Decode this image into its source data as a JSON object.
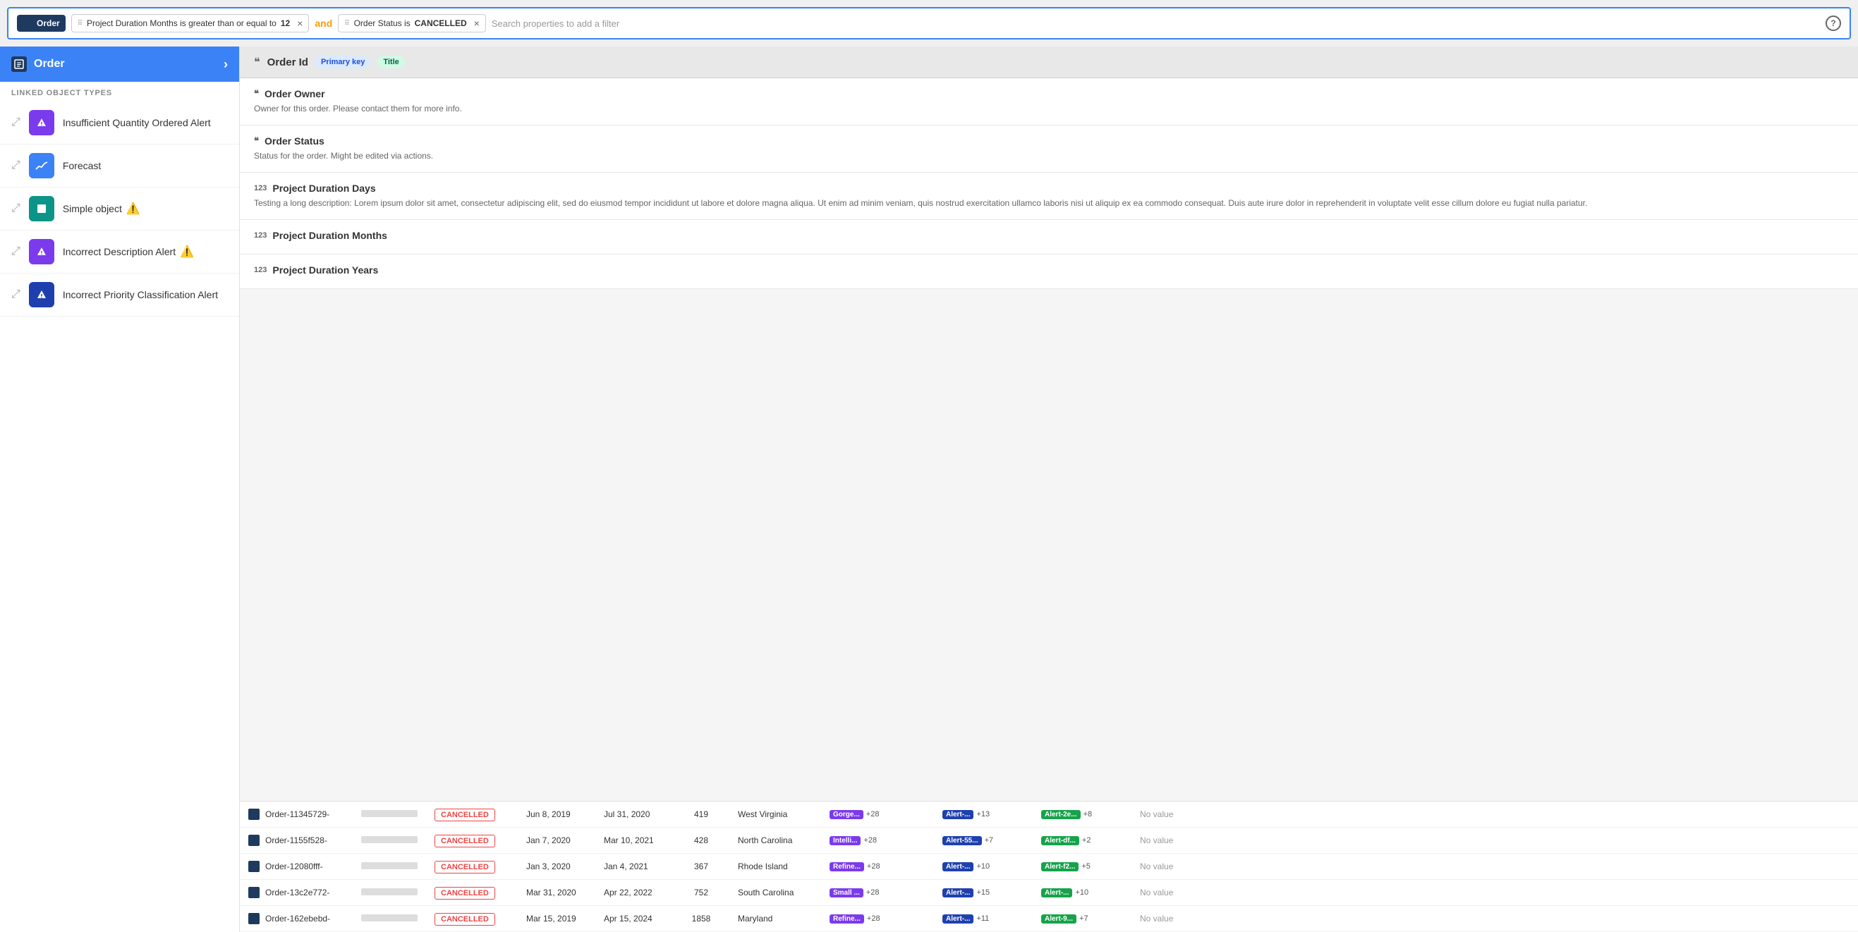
{
  "filter_bar": {
    "chip_label": "Order",
    "filter1_dots": "⠿",
    "filter1_text": "Project Duration Months is greater than or equal to",
    "filter1_value": "12",
    "filter1_close": "×",
    "and_label": "and",
    "filter2_dots": "⠿",
    "filter2_text": "Order Status is",
    "filter2_value": "CANCELLED",
    "filter2_close": "×",
    "search_placeholder": "Search properties to add a filter",
    "help_label": "?"
  },
  "sidebar": {
    "header_label": "Order",
    "linked_label": "LINKED OBJECT TYPES",
    "items": [
      {
        "name": "Insufficient Quantity Ordered Alert",
        "icon_type": "purple",
        "icon_char": "⚑",
        "has_warning": false
      },
      {
        "name": "Forecast",
        "icon_type": "blue",
        "icon_char": "📈",
        "has_warning": false
      },
      {
        "name": "Simple object",
        "icon_type": "teal",
        "icon_char": "◼",
        "has_warning": true
      },
      {
        "name": "Incorrect Description Alert",
        "icon_type": "purple",
        "icon_char": "⚑",
        "has_warning": true
      },
      {
        "name": "Incorrect Priority Classification Alert",
        "icon_type": "navy",
        "icon_char": "⚑",
        "has_warning": false
      }
    ]
  },
  "right_panel": {
    "header_field": "Order Id",
    "badge_primary": "Primary key",
    "badge_title": "Title",
    "quote_icon": "❝",
    "properties": [
      {
        "icon": "❝",
        "name": "Order Owner",
        "desc": "Owner for this order. Please contact them for more info.",
        "type": "quote"
      },
      {
        "icon": "❝",
        "name": "Order Status",
        "desc": "Status for the order. Might be edited via actions.",
        "type": "quote"
      },
      {
        "icon": "123",
        "name": "Project Duration Days",
        "desc": "Testing a long description: Lorem ipsum dolor sit amet, consectetur adipiscing elit, sed do eiusmod tempor incididunt ut labore et dolore magna aliqua. Ut enim ad minim veniam, quis nostrud exercitation ullamco laboris nisi ut aliquip ex ea commodo consequat. Duis aute irure dolor in reprehenderit in voluptate velit esse cillum dolore eu fugiat nulla pariatur.",
        "type": "number"
      },
      {
        "icon": "123",
        "name": "Project Duration Months",
        "desc": "",
        "type": "number"
      },
      {
        "icon": "123",
        "name": "Project Duration Years",
        "desc": "",
        "type": "number"
      }
    ]
  },
  "table": {
    "rows": [
      {
        "order_id": "Order-11345729-",
        "status": "CANCELLED",
        "date1": "Jun 8, 2019",
        "date2": "Jul 31, 2020",
        "num": "419",
        "state": "West Virginia",
        "tag1": "Gorge...",
        "tag1_count": "+28",
        "tag2": "Alert-...",
        "tag2_count": "+13",
        "tag3": "Alert-2e...",
        "tag3_count": "+8",
        "novalue": "No value"
      },
      {
        "order_id": "Order-1155f528-",
        "status": "CANCELLED",
        "date1": "Jan 7, 2020",
        "date2": "Mar 10, 2021",
        "num": "428",
        "state": "North Carolina",
        "tag1": "Intelli...",
        "tag1_count": "+28",
        "tag2": "Alert-55...",
        "tag2_count": "+7",
        "tag3": "Alert-df...",
        "tag3_count": "+2",
        "novalue": "No value"
      },
      {
        "order_id": "Order-12080fff-",
        "status": "CANCELLED",
        "date1": "Jan 3, 2020",
        "date2": "Jan 4, 2021",
        "num": "367",
        "state": "Rhode Island",
        "tag1": "Refine...",
        "tag1_count": "+28",
        "tag2": "Alert-...",
        "tag2_count": "+10",
        "tag3": "Alert-f2...",
        "tag3_count": "+5",
        "novalue": "No value"
      },
      {
        "order_id": "Order-13c2e772-",
        "status": "CANCELLED",
        "date1": "Mar 31, 2020",
        "date2": "Apr 22, 2022",
        "num": "752",
        "state": "South Carolina",
        "tag1": "Small ...",
        "tag1_count": "+28",
        "tag2": "Alert-...",
        "tag2_count": "+15",
        "tag3": "Alert-...",
        "tag3_count": "+10",
        "novalue": "No value"
      },
      {
        "order_id": "Order-162ebebd-",
        "status": "CANCELLED",
        "date1": "Mar 15, 2019",
        "date2": "Apr 15, 2024",
        "num": "1858",
        "state": "Maryland",
        "tag1": "Refine...",
        "tag1_count": "+28",
        "tag2": "Alert-...",
        "tag2_count": "+11",
        "tag3": "Alert-9...",
        "tag3_count": "+7",
        "novalue": "No value"
      }
    ]
  }
}
